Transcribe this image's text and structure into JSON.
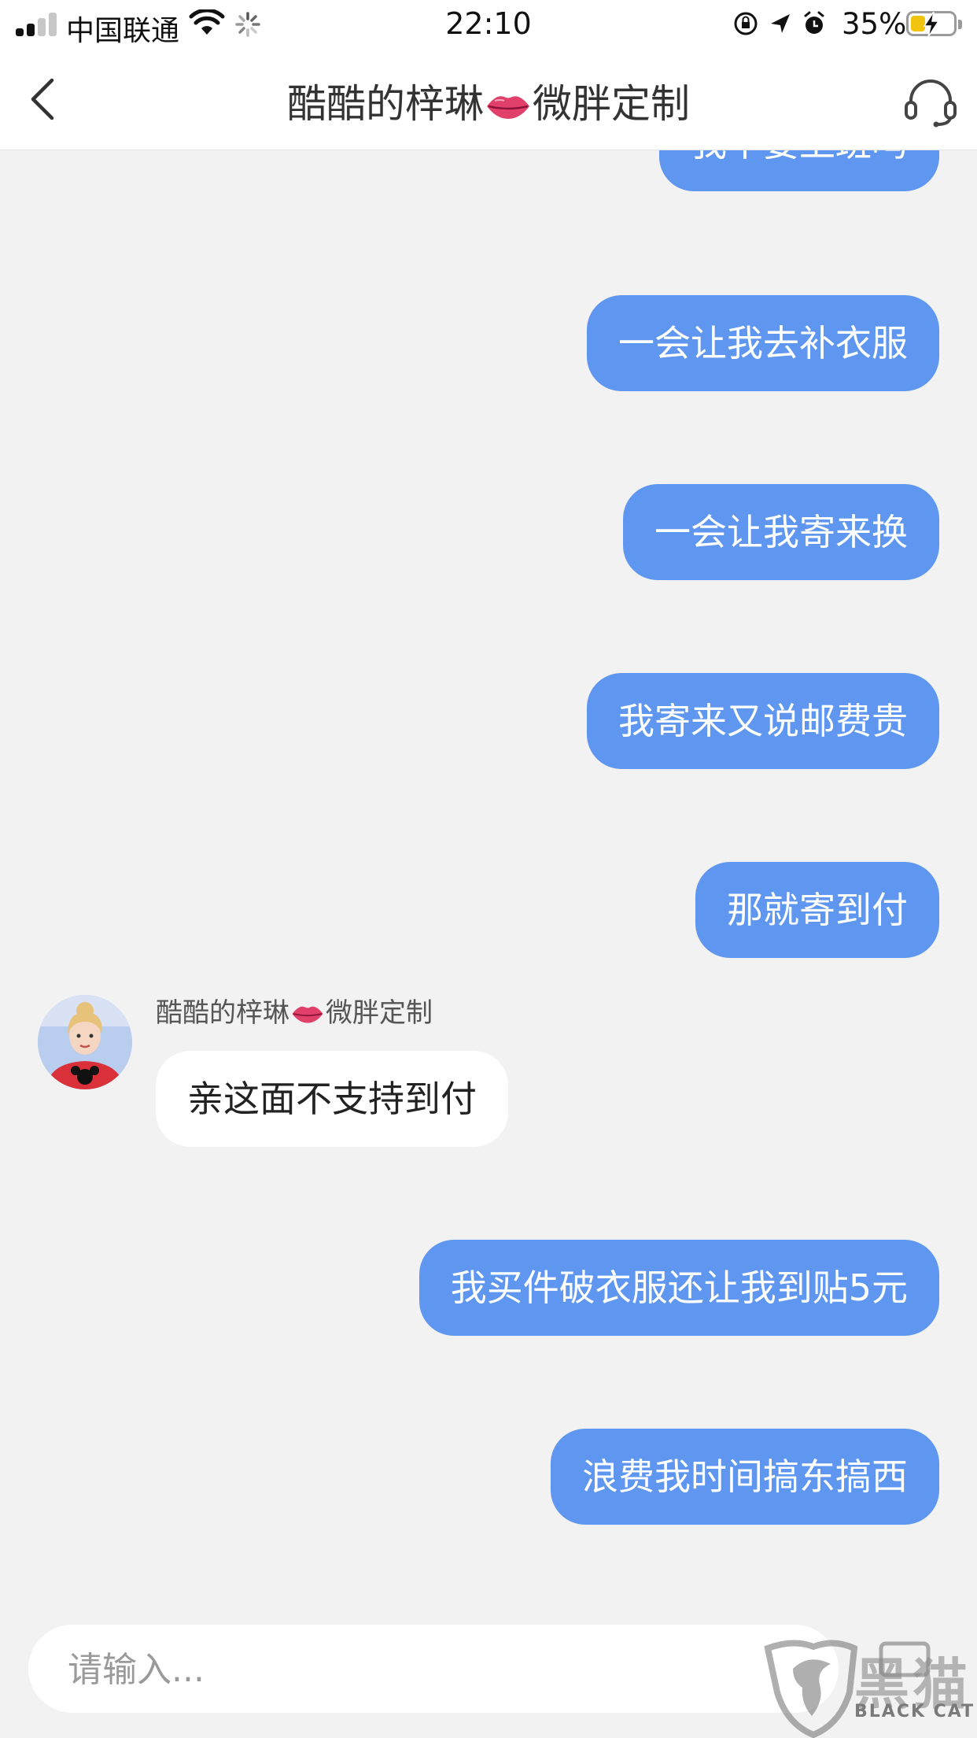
{
  "status_bar": {
    "carrier": "中国联通",
    "time": "22:10",
    "battery": "35%",
    "battery_level": 0.35,
    "icons": [
      "signal-icon",
      "wifi-icon",
      "loading-icon",
      "orientation-lock-icon",
      "location-icon",
      "alarm-icon",
      "battery-icon"
    ]
  },
  "nav": {
    "title_part1": "酷酷的梓琳",
    "title_emoji": "lips-emoji",
    "title_part2": "微胖定制",
    "back_icon": "chevron-left-icon",
    "service_icon": "headset-icon"
  },
  "chat": {
    "messages": [
      {
        "dir": "out",
        "text": "我不要上班吗"
      },
      {
        "dir": "out",
        "text": "一会让我去补衣服"
      },
      {
        "dir": "out",
        "text": "一会让我寄来换"
      },
      {
        "dir": "out",
        "text": "我寄来又说邮费贵"
      },
      {
        "dir": "out",
        "text": "那就寄到付"
      },
      {
        "dir": "in",
        "text": "亲这面不支持到付"
      },
      {
        "dir": "out",
        "text": "我买件破衣服还让我到贴5元"
      },
      {
        "dir": "out",
        "text": "浪费我时间搞东搞西"
      }
    ],
    "sender_name_part1": "酷酷的梓琳",
    "sender_name_part2": "微胖定制"
  },
  "input": {
    "placeholder": "请输入..."
  },
  "watermark": {
    "big": "黑猫",
    "small": "BLACK CAT"
  },
  "colors": {
    "outgoing_bubble": "#5f97f0",
    "incoming_bubble": "#ffffff",
    "background": "#f2f2f2",
    "battery_fill": "#f1c40f"
  }
}
